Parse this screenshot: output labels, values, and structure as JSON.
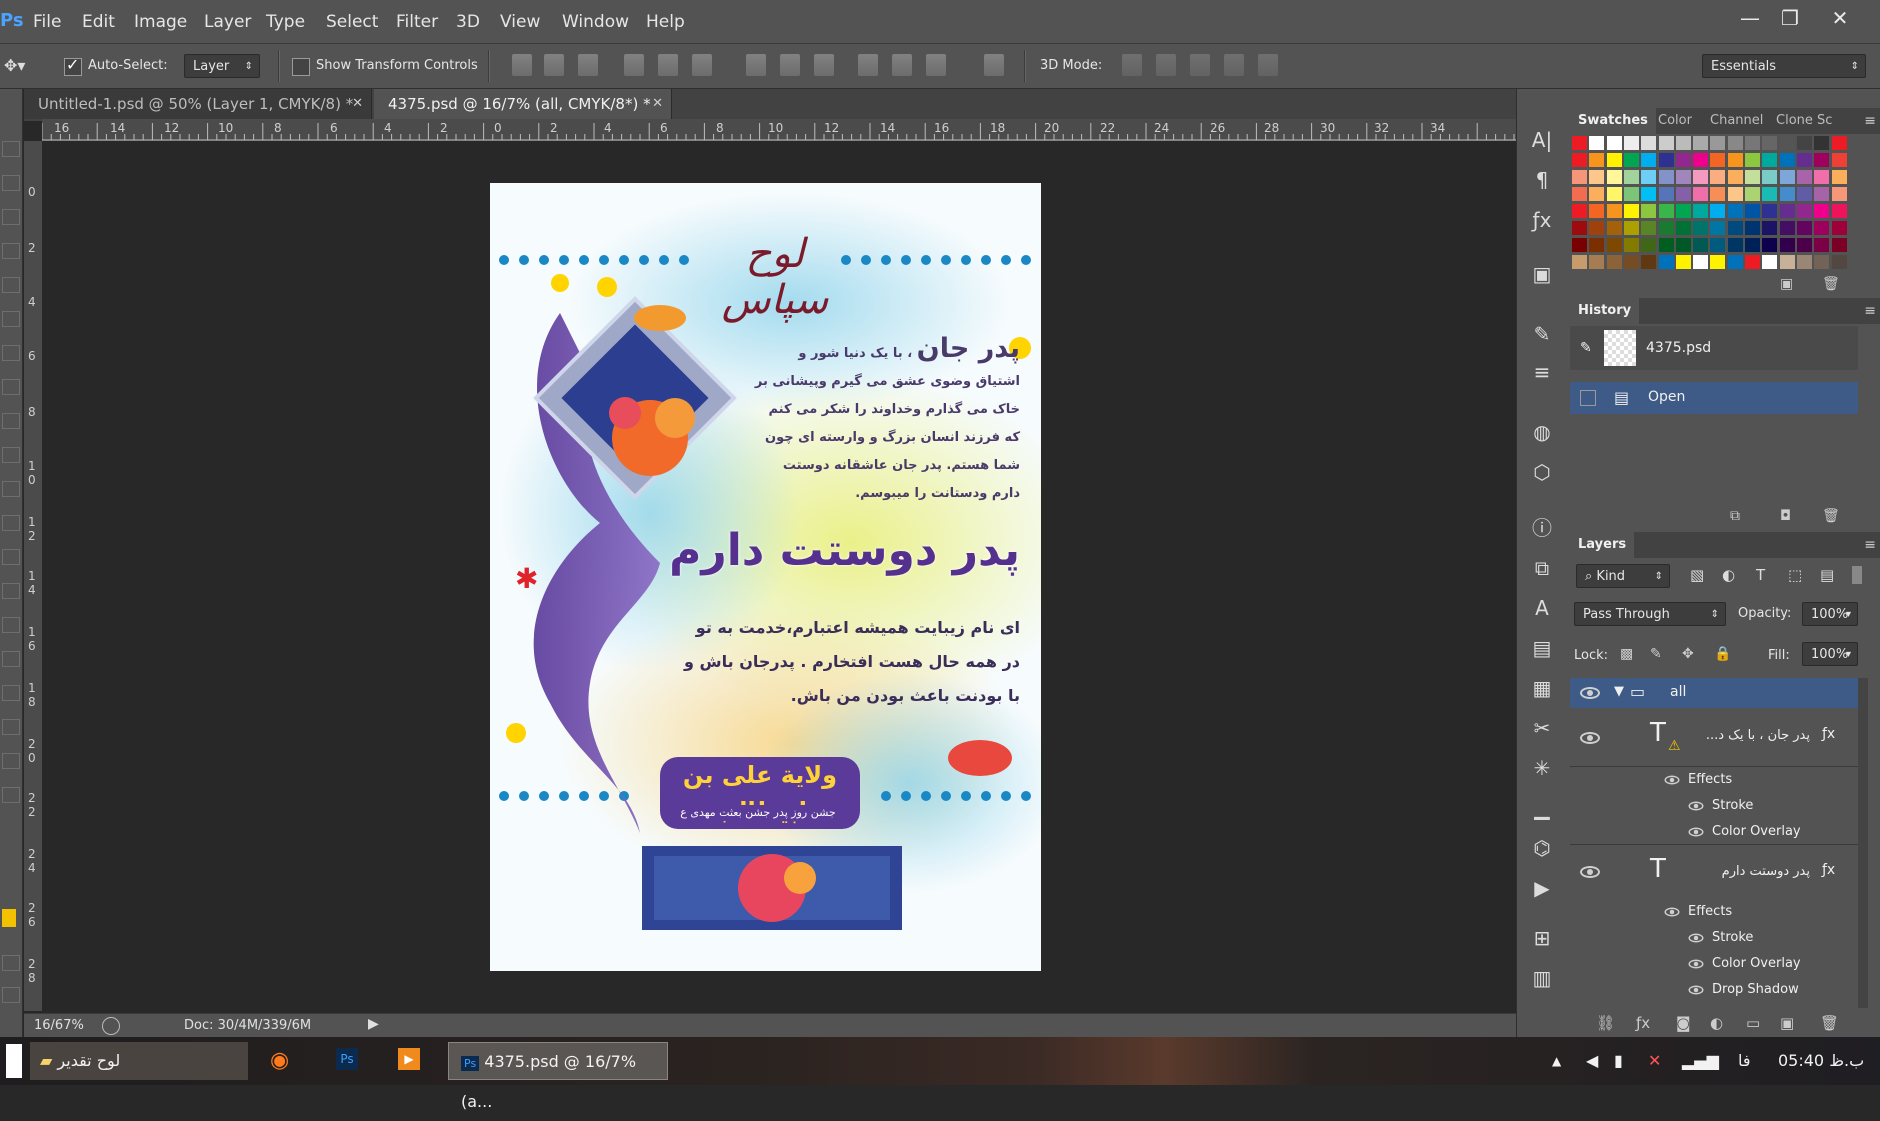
{
  "app": {
    "logo": "Ps"
  },
  "menu": [
    "File",
    "Edit",
    "Image",
    "Layer",
    "Type",
    "Select",
    "Filter",
    "3D",
    "View",
    "Window",
    "Help"
  ],
  "window_controls": [
    "—",
    "❐",
    "✕"
  ],
  "options": {
    "auto_select_label": "Auto-Select:",
    "auto_select_value": "Layer",
    "show_transform_label": "Show Transform Controls",
    "mode_3d_label": "3D Mode:",
    "workspace": "Essentials"
  },
  "tabs": [
    {
      "label": "Untitled-1.psd @ 50% (Layer 1, CMYK/8) *",
      "active": false
    },
    {
      "label": "4375.psd @ 16/7% (all, CMYK/8*) *",
      "active": true
    }
  ],
  "ruler_h": [
    "16",
    "14",
    "12",
    "10",
    "8",
    "6",
    "4",
    "2",
    "0",
    "2",
    "4",
    "6",
    "8",
    "10",
    "12",
    "14",
    "16",
    "18",
    "20",
    "22",
    "24",
    "26",
    "28",
    "30",
    "32",
    "34"
  ],
  "ruler_v": [
    "0",
    "2",
    "4",
    "6",
    "8",
    "1 0",
    "1 2",
    "1 4",
    "1 6",
    "1 8",
    "2 0",
    "2 2",
    "2 4",
    "2 6",
    "2 8"
  ],
  "status": {
    "zoom": "16/67%",
    "doc": "Doc: 30/4M/339/6M"
  },
  "swatch_panel": {
    "tabs": [
      "Swatches",
      "Color",
      "Channel",
      "Clone Sc"
    ],
    "colors": [
      [
        "#ed1c24",
        "#ffffff",
        "#ffffff",
        "#eeeeee",
        "#dddddd",
        "#cccccc",
        "#bbbbbb",
        "#aaaaaa",
        "#999999",
        "#888888",
        "#777777",
        "#666666",
        "#555555",
        "#444444",
        "#333333",
        "#ed1c24"
      ],
      [
        "#ed1c24",
        "#f7941d",
        "#fff200",
        "#00a651",
        "#00aeef",
        "#2e3192",
        "#92278f",
        "#ec008c",
        "#f26522",
        "#f7941d",
        "#8dc63f",
        "#00a99d",
        "#0072bc",
        "#662d91",
        "#9e005d",
        "#ee4035"
      ],
      [
        "#f69679",
        "#fdc68a",
        "#fff799",
        "#a3d39c",
        "#6dcff6",
        "#8393ca",
        "#a186be",
        "#f49ac1",
        "#f9ad81",
        "#fbaf5d",
        "#c4df9b",
        "#7accc8",
        "#7da7d9",
        "#a864a8",
        "#f06eaa",
        "#fbaf5d"
      ],
      [
        "#f26c4f",
        "#fbaf5d",
        "#fff568",
        "#7cc576",
        "#00bff3",
        "#5674b9",
        "#8560a8",
        "#f06eaa",
        "#f68e55",
        "#fdc689",
        "#acd372",
        "#1abbb4",
        "#448ccb",
        "#605ca8",
        "#a763a8",
        "#f7977a"
      ],
      [
        "#ed1c24",
        "#f26522",
        "#f7941d",
        "#fff200",
        "#8dc63f",
        "#39b54a",
        "#00a651",
        "#00a99d",
        "#00aeef",
        "#0072bc",
        "#0054a6",
        "#2e3192",
        "#662d91",
        "#92278f",
        "#ec008c",
        "#ed145b"
      ],
      [
        "#9e0b0f",
        "#a0410d",
        "#a3620a",
        "#aba000",
        "#598527",
        "#197b30",
        "#007236",
        "#00746b",
        "#0076a3",
        "#004a80",
        "#003471",
        "#1b1464",
        "#440e62",
        "#630460",
        "#9e005d",
        "#9e0039"
      ],
      [
        "#790000",
        "#7b2e00",
        "#7d4900",
        "#827b00",
        "#406618",
        "#005e20",
        "#005826",
        "#005952",
        "#005b7f",
        "#003663",
        "#002157",
        "#0d004c",
        "#32004b",
        "#4b0049",
        "#7b0046",
        "#7a0026"
      ],
      [
        "#c69c6d",
        "#a67c52",
        "#8c6239",
        "#754c24",
        "#603913",
        "#0072bc",
        "#fff200",
        "#ffffff",
        "#fff200",
        "#0072bc",
        "#ed1c24",
        "#ffffff",
        "#c7b299",
        "#998675",
        "#736357",
        "#534741"
      ]
    ]
  },
  "history": {
    "title": "History",
    "doc": "4375.psd",
    "items": [
      "Open"
    ]
  },
  "layers": {
    "title": "Layers",
    "kind": "Kind",
    "blend": "Pass Through",
    "opacity_label": "Opacity:",
    "opacity": "100%",
    "lock_label": "Lock:",
    "fill_label": "Fill:",
    "fill": "100%",
    "group": "all",
    "layer1": "پدر جان ، با یک د...",
    "layer2": "پدر دوستت دارم",
    "effects": "Effects",
    "stroke": "Stroke",
    "color_overlay": "Color Overlay",
    "drop_shadow": "Drop Shadow"
  },
  "poster": {
    "title": "لوح سپاس",
    "heading": "پدر جان",
    "para1_lines": [
      "، با یک دنیا شور و",
      "اشتیاق وضوی عشق می گیرم وپیشانی بر",
      "خاک می گذارم وخداوند را شکر می کنم",
      "که فرزند انسان بزرگ و وارسته ای چون",
      "شما هستم. پدر جان عاشقانه دوستت",
      "دارم ودستانت را میبوسم."
    ],
    "big_line": "پدر دوستت دارم",
    "para2_lines": [
      "ای نام زیبایت همیشه اعتبارم،خدمت به تو",
      "در همه حال هست افتخارم . پدرجان باش و",
      "با بودنت باعث بودن من باش."
    ],
    "badge": "ولایة علی بن ابیطالب",
    "badge_sub": "جشن روز پدر جشن بعثت مهدی ع"
  },
  "taskbar": {
    "folder": "لوح تقدیر",
    "active_app": "4375.psd @ 16/7% (a...",
    "lang": "فا",
    "time": "05:40 ب.ظ"
  }
}
